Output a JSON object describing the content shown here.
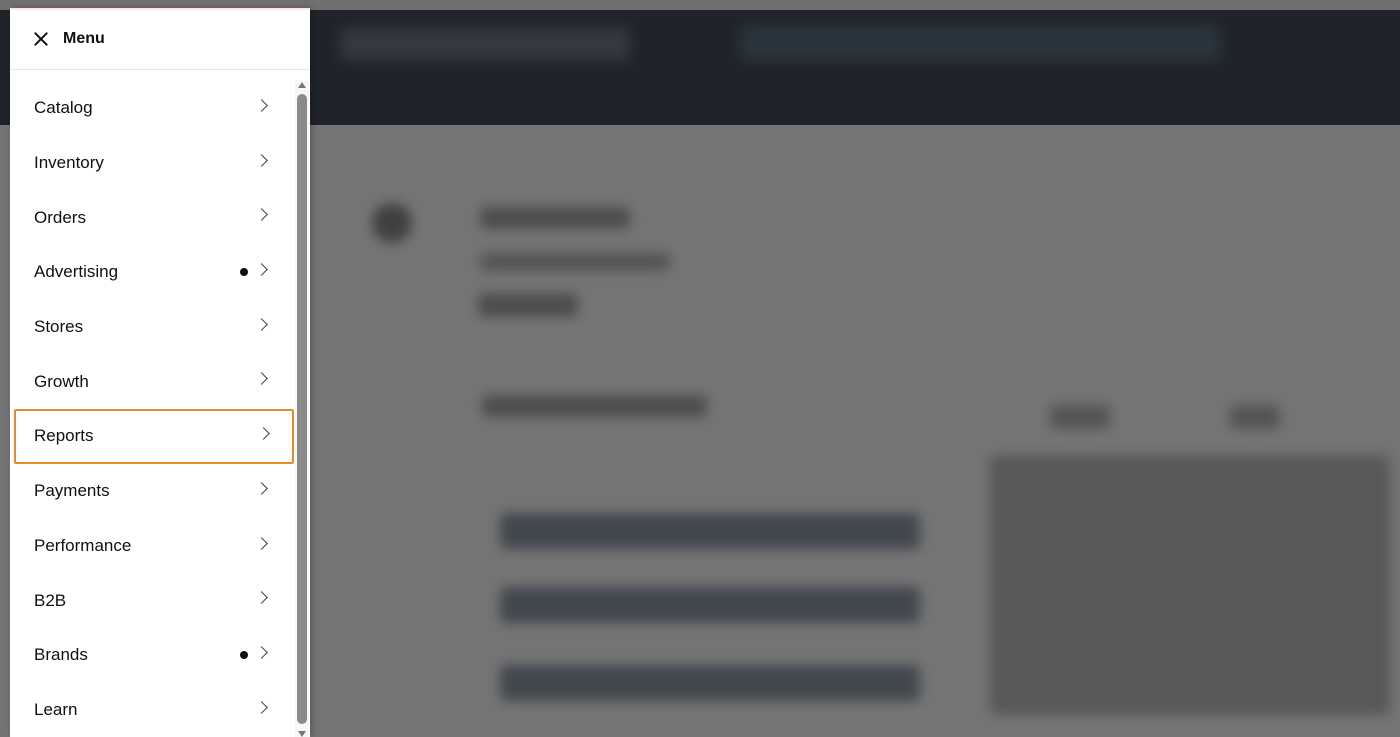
{
  "menu": {
    "title": "Menu",
    "close_icon": "close-icon",
    "items": [
      {
        "label": "Catalog",
        "has_dot": false
      },
      {
        "label": "Inventory",
        "has_dot": false
      },
      {
        "label": "Orders",
        "has_dot": false
      },
      {
        "label": "Advertising",
        "has_dot": true
      },
      {
        "label": "Stores",
        "has_dot": false
      },
      {
        "label": "Growth",
        "has_dot": false
      },
      {
        "label": "Reports",
        "has_dot": false,
        "highlighted": true
      },
      {
        "label": "Payments",
        "has_dot": false
      },
      {
        "label": "Performance",
        "has_dot": false
      },
      {
        "label": "B2B",
        "has_dot": false
      },
      {
        "label": "Brands",
        "has_dot": true
      },
      {
        "label": "Learn",
        "has_dot": false
      }
    ]
  },
  "colors": {
    "highlight_outline": "#e88b2e",
    "topbar": "#232f3e",
    "overlay": "rgba(30,30,30,0.62)"
  }
}
